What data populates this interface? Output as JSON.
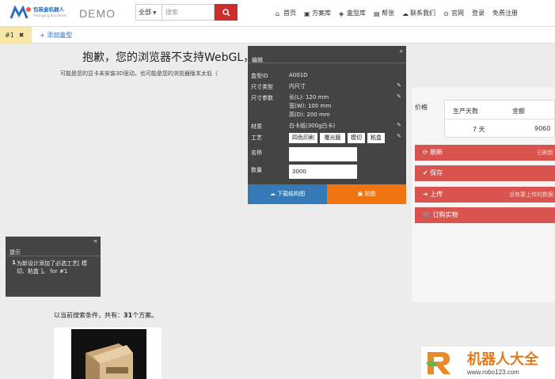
{
  "header": {
    "logo_text": "包装盒机器人",
    "logo_sub": "Packaging Box Robot",
    "demo_label": "DEMO",
    "search_scope": "全部",
    "search_placeholder": "搜索",
    "nav": [
      "首页",
      "方案库",
      "盒型库",
      "帮张",
      "联系我们",
      "官网",
      "登录",
      "免费注册"
    ]
  },
  "tabs": {
    "active": "#1",
    "add_label": "添加盒型"
  },
  "main": {
    "webgl_title": "抱歉，您的浏览器不支持WebGL，从",
    "webgl_sub": "可能是您的显卡未安装3D驱动，也可能是您的浏览器版本太低（"
  },
  "edit_panel": {
    "title": "编辑",
    "collapse": "«",
    "rows": [
      {
        "label": "盒型ID",
        "value": "A001D"
      },
      {
        "label": "尺寸类型",
        "value": "内尺寸"
      },
      {
        "label": "尺寸参数",
        "value": [
          "长(L): 120 mm",
          "宽(W): 100 mm",
          "高(D): 200 mm"
        ]
      },
      {
        "label": "材质",
        "value": "白卡纸(300g白卡)"
      },
      {
        "label": "工艺",
        "value": [
          "四色印刷",
          "覆光膜",
          "模切",
          "粘盒"
        ]
      },
      {
        "label": "名称",
        "value": ""
      },
      {
        "label": "数量",
        "value": "3000"
      }
    ],
    "btn_download": "下载结构图",
    "btn_map": "贴图"
  },
  "tip_panel": {
    "title": "提示",
    "collapse": "«",
    "num": "1",
    "message": "为新设计添加了必选工艺[ 模切、粘盒 ]。 for #1"
  },
  "price": {
    "label": "价格",
    "headers": [
      "生产天数",
      "金额"
    ],
    "days": "7 天",
    "amount": "9060"
  },
  "actions": [
    {
      "label": "刷新",
      "note": "已刷新"
    },
    {
      "label": "保存",
      "note": ""
    },
    {
      "label": "上传",
      "note": "没有要上传的数据"
    },
    {
      "label": "订购实物",
      "note": ""
    }
  ],
  "results": {
    "prefix": "以当前搜索条件，共有：",
    "count": "31",
    "suffix": "个方案。"
  },
  "watermark": {
    "title": "机器人大全",
    "url": "www.robo123.com"
  },
  "colors": {
    "accent_red": "#d9534f",
    "primary_blue": "#337ab7",
    "orange": "#f0740f",
    "panel_dark": "#444444"
  }
}
